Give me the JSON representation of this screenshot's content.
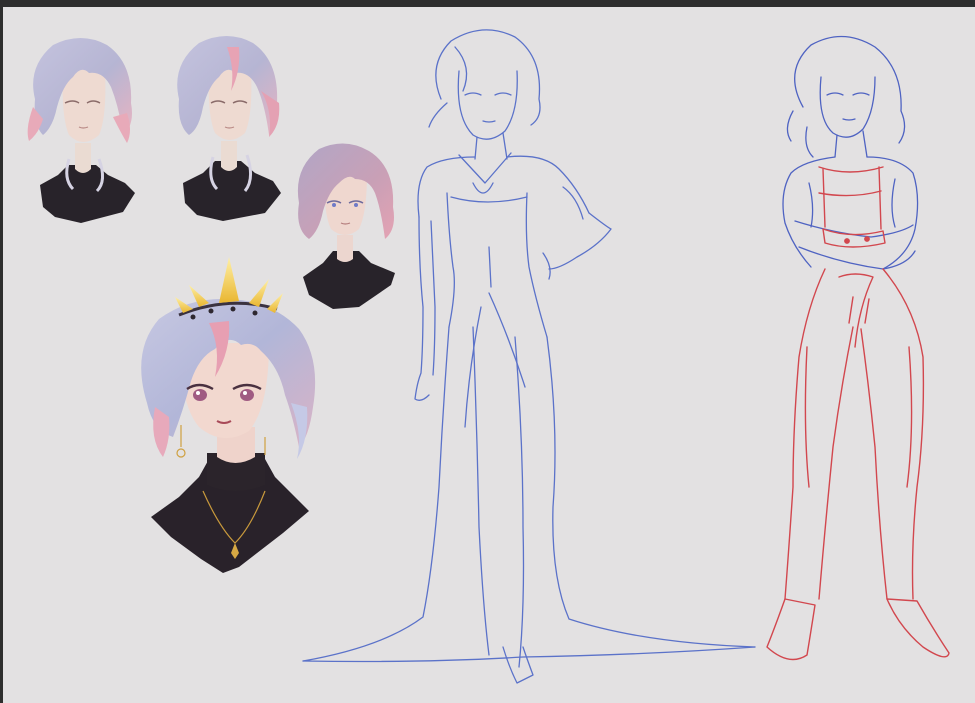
{
  "canvas": {
    "background_color": "#e3e1e2",
    "frame_color": "#2e2e2e"
  },
  "artwork": {
    "subject": "character-design-sheet",
    "palette": {
      "hair_lilac": "#b9b7d6",
      "hair_pink": "#e6a9b9",
      "skin": "#f0ddd6",
      "turtleneck": "#2a2329",
      "gold": "#f2c84b",
      "sketch_blue": "#5b72c9",
      "sketch_red": "#d2474e"
    },
    "elements": [
      "head-study-1",
      "head-study-2",
      "head-study-3",
      "crowned-portrait",
      "gown-figure-sketch",
      "casual-figure-sketch"
    ]
  }
}
